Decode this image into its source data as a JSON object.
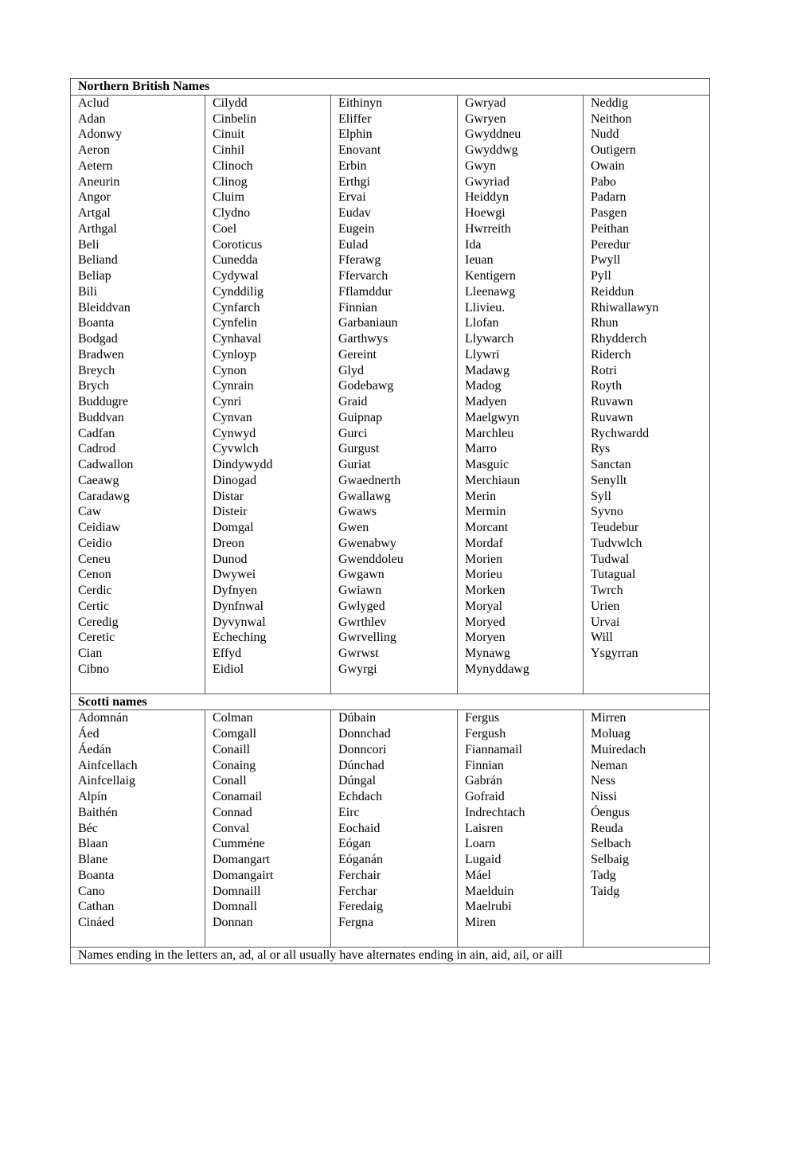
{
  "sections": [
    {
      "title": "Northern British Names",
      "columns": [
        [
          "Aclud",
          "Adan",
          "Adonwy",
          "Aeron",
          "Aetern",
          "Aneurin",
          "Angor",
          "Artgal",
          "Arthgal",
          "Beli",
          "Beliand",
          "Beliap",
          "Bili",
          "Bleiddvan",
          "Boanta",
          "Bodgad",
          "Bradwen",
          "Breych",
          "Brych",
          "Buddugre",
          "Buddvan",
          "Cadfan",
          "Cadrod",
          "Cadwallon",
          "Caeawg",
          "Caradawg",
          "Caw",
          "Ceidiaw",
          "Ceidio",
          "Ceneu",
          "Cenon",
          "Cerdic",
          "Certic",
          "Ceredig",
          "Ceretic",
          "Cian",
          "Cibno"
        ],
        [
          "Cilydd",
          "Cinbelin",
          "Cinuit",
          "Cinhil",
          "Clinoch",
          "Clinog",
          "Cluim",
          "Clydno",
          "Coel",
          "Coroticus",
          "Cunedda",
          "Cydywal",
          "Cynddilig",
          "Cynfarch",
          "Cynfelin",
          "Cynhaval",
          "Cynloyp",
          "Cynon",
          "Cynrain",
          "Cynri",
          "Cynvan",
          "Cynwyd",
          "Cyvwlch",
          "Dindywydd",
          "Dinogad",
          "Distar",
          "Disteir",
          "Domgal",
          "Dreon",
          "Dunod",
          "Dwywei",
          "Dyfnyen",
          "Dynfnwal",
          "Dyvynwal",
          "Echeching",
          "Effyd",
          "Eidiol"
        ],
        [
          "Eithinyn",
          "Eliffer",
          "Elphin",
          "Enovant",
          "Erbin",
          "Erthgi",
          "Ervai",
          "Eudav",
          "Eugein",
          "Eulad",
          "Fferawg",
          "Ffervarch",
          "Fflamddur",
          "Finnian",
          "Garbaniaun",
          "Garthwys",
          "Gereint",
          "Glyd",
          "Godebawg",
          "Graid",
          "Guipnap",
          "Gurci",
          "Gurgust",
          "Guriat",
          "Gwaednerth",
          "Gwallawg",
          "Gwaws",
          "Gwen",
          "Gwenabwy",
          "Gwenddoleu",
          "Gwgawn",
          "Gwiawn",
          "Gwlyged",
          "Gwrthlev",
          "Gwrvelling",
          "Gwrwst",
          "Gwyrgi"
        ],
        [
          "Gwryad",
          "Gwryen",
          "Gwyddneu",
          "Gwyddwg",
          "Gwyn",
          "Gwyriad",
          "Heiddyn",
          "Hoewgi",
          "Hwrreith",
          "Ida",
          "Ieuan",
          "Kentigern",
          "Lleenawg",
          "Llivieu.",
          "Llofan",
          "Llywarch",
          "Llywri",
          "Madawg",
          "Madog",
          "Madyen",
          "Maelgwyn",
          "Marchleu",
          "Marro",
          "Masguic",
          "Merchiaun",
          "Merin",
          "Mermin",
          "Morcant",
          "Mordaf",
          "Morien",
          "Morieu",
          "Morken",
          "Moryal",
          "Moryed",
          "Moryen",
          "Mynawg",
          "Mynyddawg"
        ],
        [
          "Neddig",
          "Neithon",
          "Nudd",
          "Outigern",
          "Owain",
          "Pabo",
          "Padarn",
          "Pasgen",
          "Peithan",
          "Peredur",
          "Pwyll",
          "Pyll",
          "Reiddun",
          "Rhiwallawyn",
          "Rhun",
          "Rhydderch",
          "Riderch",
          "Rotri",
          "Royth",
          "Ruvawn",
          "Ruvawn",
          "Rychwardd",
          "Rys",
          "Sanctan",
          "Senyllt",
          "Syll",
          "Syvno",
          "Teudebur",
          "Tudvwlch",
          "Tudwal",
          "Tutagual",
          "Twrch",
          "Urien",
          "Urvai",
          "Will",
          "Ysgyrran"
        ]
      ]
    },
    {
      "title": "Scotti names",
      "columns": [
        [
          "Adomnán",
          "Áed",
          "Áedán",
          "Ainfcellach",
          "Ainfcellaig",
          "Alpín",
          "Baithén",
          "Béc",
          "Blaan",
          "Blane",
          "Boanta",
          "Cano",
          "Cathan",
          "Cináed"
        ],
        [
          "Colman",
          "Comgall",
          "Conaill",
          "Conaing",
          "Conall",
          "Conamail",
          "Connad",
          "Conval",
          "Cumméne",
          "Domangart",
          "Domangairt",
          "Domnaill",
          "Domnall",
          "Donnan"
        ],
        [
          "Dúbain",
          "Donnchad",
          "Donncori",
          "Dúnchad",
          "Dúngal",
          "Echdach",
          "Eirc",
          "Eochaid",
          "Eógan",
          "Eóganán",
          "Ferchair",
          "Ferchar",
          "Feredaig",
          "Fergna"
        ],
        [
          "Fergus",
          "Fergush",
          "Fiannamail",
          "Finnian",
          "Gabrán",
          "Gofraid",
          "Indrechtach",
          "Laisren",
          "Loarn",
          "Lugaid",
          "Máel",
          "Maelduin",
          "Maelrubi",
          "Miren"
        ],
        [
          "Mirren",
          "Moluag",
          "Muiredach",
          "Neman",
          "Ness",
          "Nissi",
          "Óengus",
          "Reuda",
          "Selbach",
          "Selbaig",
          "Tadg",
          "Taidg"
        ]
      ]
    }
  ],
  "footnote": "Names ending in the letters an, ad, al  or all usually have alternates ending in ain, aid, ail, or aill"
}
